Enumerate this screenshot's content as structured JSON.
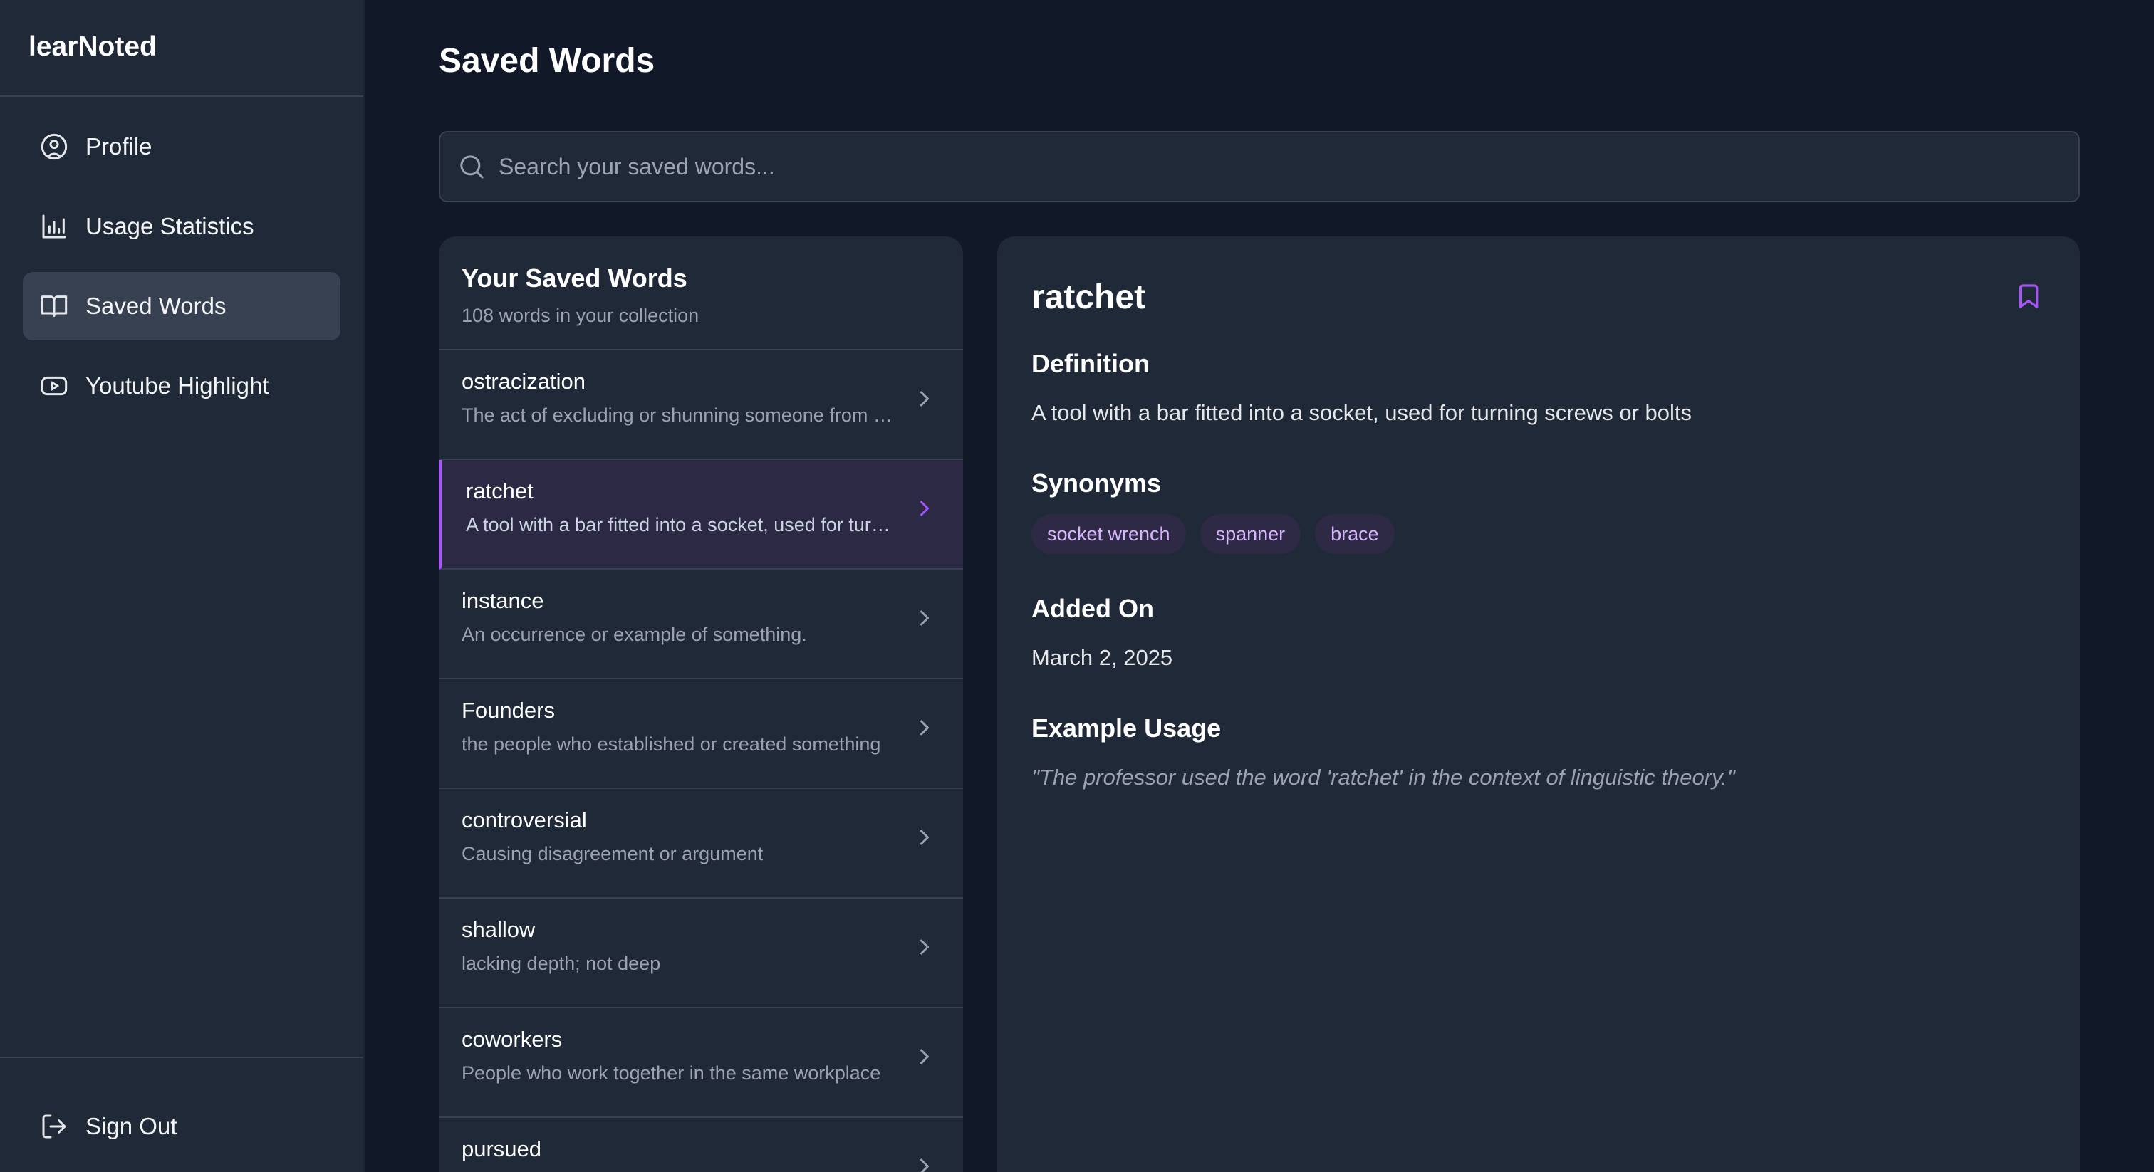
{
  "app": {
    "brand": "learNoted"
  },
  "sidebar": {
    "items": [
      {
        "label": "Profile",
        "icon": "user-circle-icon"
      },
      {
        "label": "Usage Statistics",
        "icon": "bar-chart-icon"
      },
      {
        "label": "Saved Words",
        "icon": "book-open-icon",
        "active": true
      },
      {
        "label": "Youtube Highlight",
        "icon": "youtube-icon"
      }
    ],
    "sign_out": "Sign Out"
  },
  "main": {
    "title": "Saved Words",
    "search": {
      "placeholder": "Search your saved words...",
      "value": ""
    }
  },
  "list": {
    "title": "Your Saved Words",
    "subtitle": "108 words in your collection",
    "words": [
      {
        "word": "ostracization",
        "definition": "The act of excluding or shunning someone from a group"
      },
      {
        "word": "ratchet",
        "definition": "A tool with a bar fitted into a socket, used for turning screws or bolts",
        "selected": true
      },
      {
        "word": "instance",
        "definition": "An occurrence or example of something."
      },
      {
        "word": "Founders",
        "definition": "the people who established or created something"
      },
      {
        "word": "controversial",
        "definition": "Causing disagreement or argument"
      },
      {
        "word": "shallow",
        "definition": "lacking depth; not deep"
      },
      {
        "word": "coworkers",
        "definition": "People who work together in the same workplace"
      },
      {
        "word": "pursued",
        "definition": ""
      }
    ]
  },
  "detail": {
    "word": "ratchet",
    "definition_label": "Definition",
    "definition": "A tool with a bar fitted into a socket, used for turning screws or bolts",
    "synonyms_label": "Synonyms",
    "synonyms": [
      "socket wrench",
      "spanner",
      "brace"
    ],
    "added_label": "Added On",
    "added_on": "March 2, 2025",
    "example_label": "Example Usage",
    "example": "\"The professor used the word 'ratchet' in the context of linguistic theory.\""
  },
  "colors": {
    "background": "#111827",
    "panel": "#1f2937",
    "accent": "#a855f7",
    "chip_bg": "#2e2a45",
    "chip_text": "#d8b4fe"
  }
}
